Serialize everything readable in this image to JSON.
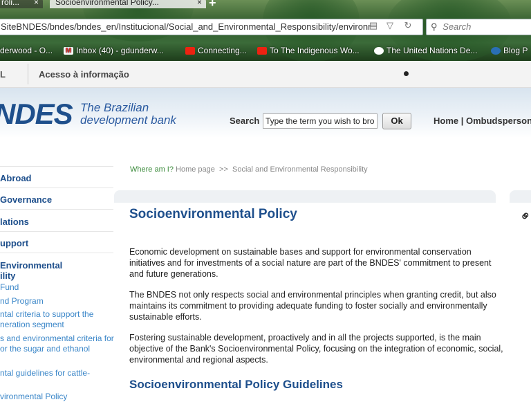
{
  "browser": {
    "tabs": [
      {
        "label": "roli..."
      },
      {
        "label": "Socioenvironmental Policy..."
      }
    ],
    "close_glyph": "×",
    "new_tab_glyph": "+",
    "url": "SiteBNDES/bndes/bndes_en/Institucional/Social_and_Environmental_Responsibility/environr",
    "search_placeholder": "Search",
    "bookmarks": [
      {
        "label": "rderwood - O...",
        "icon": "none"
      },
      {
        "label": "Inbox (40) - gdunderw...",
        "icon": "gmail-icon"
      },
      {
        "label": "Connecting...",
        "icon": "youtube-icon"
      },
      {
        "label": "To The Indigenous Wo...",
        "icon": "youtube-icon"
      },
      {
        "label": "The United Nations De...",
        "icon": "un-icon"
      },
      {
        "label": "Blog P",
        "icon": "wordpress-icon"
      }
    ]
  },
  "topnav": {
    "left_label": "L",
    "access_label": "Acesso à informação"
  },
  "header": {
    "logo": "NDES",
    "tagline_line1": "The Brazilian",
    "tagline_line2": "development bank",
    "search_label": "Search",
    "search_value": "Type the term you wish to bro",
    "ok_label": "Ok",
    "links": "Home  |  Ombudsperson"
  },
  "sidebar": {
    "main_items": [
      "Abroad",
      "Governance",
      "lations",
      "upport"
    ],
    "active_title_line1": "Environmental",
    "active_title_line2": "ility",
    "sub_items": [
      "Fund",
      "nd Program",
      "ntal criteria to support the",
      "neration segment",
      "s and environmental criteria for",
      "or the sugar and ethanol",
      "ntal guidelines for cattle-",
      "vironmental Policy"
    ]
  },
  "breadcrumb": {
    "where": "Where am I?",
    "home": "Home page",
    "sep": ">>",
    "current": "Social and Environmental Responsibility"
  },
  "main": {
    "title": "Socioenvironmental Policy",
    "paragraphs": [
      "Economic development on sustainable bases and support for environmental conservation initiatives and for investments of a social nature are part of the BNDES' commitment to present and future generations.",
      "The BNDES not only respects social and environmental principles when granting credit, but also maintains its commitment to providing adequate funding to foster socially and environmentally sustainable efforts.",
      "Fostering sustainable development, proactively and in all the projects supported, is the main objective of the Bank's Socioenvironmental Policy, focusing on the integration of economic, social, environmental and regional aspects."
    ],
    "subtitle": "Socioenvironmental Policy Guidelines"
  }
}
